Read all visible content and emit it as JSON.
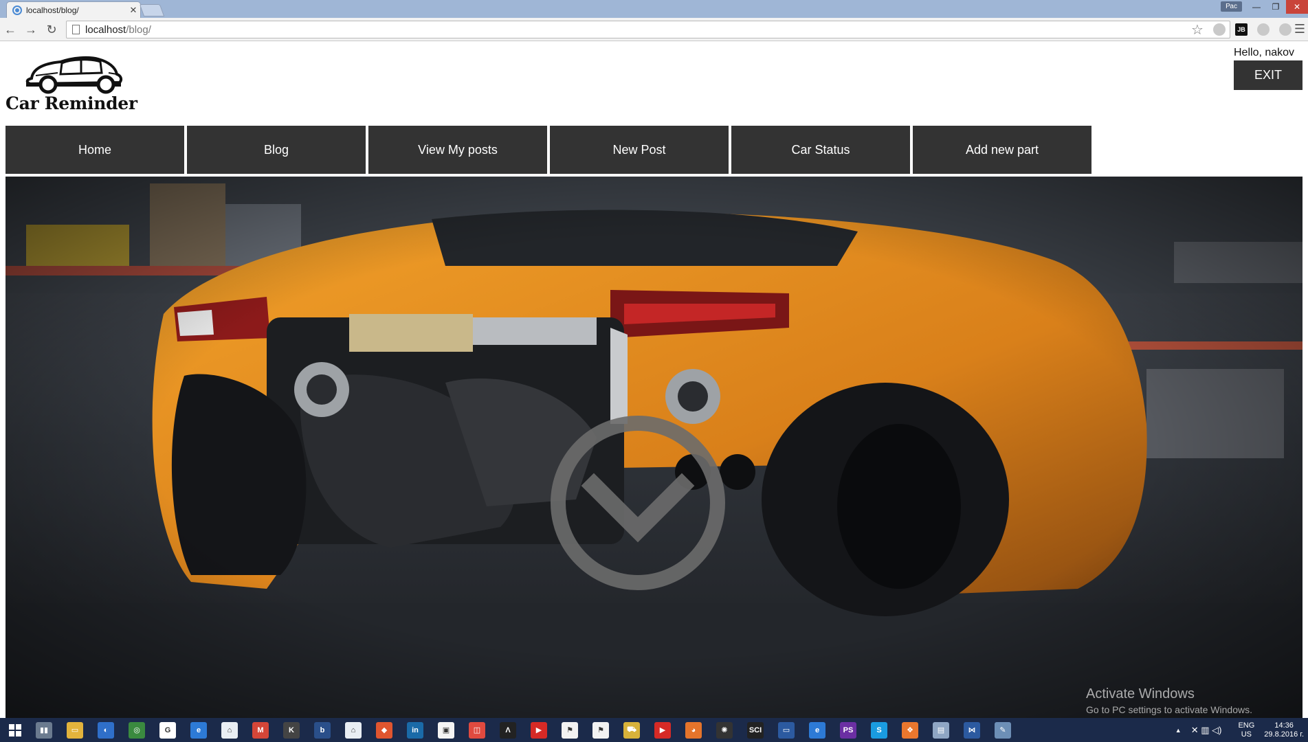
{
  "browser": {
    "tab_title": "localhost/blog/",
    "tab_close": "✕",
    "user_badge": "Рас",
    "window_controls": {
      "minimize": "—",
      "maximize": "❐",
      "close": "✕"
    },
    "address": {
      "host": "localhost",
      "path": "/blog/"
    },
    "nav_icons": {
      "back": "←",
      "forward": "→",
      "reload": "↻"
    },
    "bookmark_star": "☆",
    "menu_icon": "☰",
    "extensions": [
      {
        "name": "cloud-extension-icon",
        "label": ""
      },
      {
        "name": "jetbrains-extension-icon",
        "label": "JB"
      },
      {
        "name": "grey-circle-extension-icon",
        "label": ""
      },
      {
        "name": "m-extension-icon",
        "label": ""
      }
    ]
  },
  "site": {
    "logo_text": "Car Reminder",
    "greeting": "Hello, nakov",
    "exit_label": "EXIT",
    "nav": [
      {
        "label": "Home"
      },
      {
        "label": "Blog"
      },
      {
        "label": "View My posts"
      },
      {
        "label": "New Post"
      },
      {
        "label": "Car Status"
      },
      {
        "label": "Add new part"
      }
    ]
  },
  "watermark": {
    "line1": "Activate Windows",
    "line2": "Go to PC settings to activate Windows."
  },
  "taskbar": {
    "apps": [
      {
        "name": "file-explorer-pinned-icon",
        "color": "#6b7b8f",
        "label": "▮▮"
      },
      {
        "name": "folder-icon",
        "color": "#e2b33c",
        "label": "▭"
      },
      {
        "name": "firefox-icon",
        "color": "#2f6fc9",
        "label": "◐"
      },
      {
        "name": "chrome-icon",
        "color": "#3a8a3f",
        "label": "◎"
      },
      {
        "name": "google-icon",
        "color": "#ffffff",
        "label": "G"
      },
      {
        "name": "internet-explorer-icon",
        "color": "#2d7ad6",
        "label": "e"
      },
      {
        "name": "app-icon-1",
        "color": "#e9eef4",
        "label": "⌂"
      },
      {
        "name": "gmail-icon",
        "color": "#d44638",
        "label": "M"
      },
      {
        "name": "app-icon-2",
        "color": "#444444",
        "label": "K"
      },
      {
        "name": "bitbucket-icon",
        "color": "#2a4f8a",
        "label": "b"
      },
      {
        "name": "app-icon-3",
        "color": "#e9eef4",
        "label": "⌂"
      },
      {
        "name": "git-icon",
        "color": "#e0552f",
        "label": "◆"
      },
      {
        "name": "linkedin-icon",
        "color": "#1a6aa8",
        "label": "in"
      },
      {
        "name": "app-icon-4",
        "color": "#f4f4f4",
        "label": "▣"
      },
      {
        "name": "app-icon-5",
        "color": "#e04a3f",
        "label": "◫"
      },
      {
        "name": "app-icon-6",
        "color": "#222222",
        "label": "Λ"
      },
      {
        "name": "youtube-icon",
        "color": "#d62a26",
        "label": "▶"
      },
      {
        "name": "app-icon-7",
        "color": "#f2f2f2",
        "label": "⚑"
      },
      {
        "name": "app-icon-8",
        "color": "#f2f2f2",
        "label": "⚑"
      },
      {
        "name": "app-icon-9",
        "color": "#d8b23a",
        "label": "⛟"
      },
      {
        "name": "youtube-2-icon",
        "color": "#d62a26",
        "label": "▶"
      },
      {
        "name": "app-icon-10",
        "color": "#e5742b",
        "label": "◕"
      },
      {
        "name": "app-icon-11",
        "color": "#333333",
        "label": "✺"
      },
      {
        "name": "sci-icon",
        "color": "#222222",
        "label": "SCI"
      },
      {
        "name": "app-icon-12",
        "color": "#2c5aa0",
        "label": "▭"
      },
      {
        "name": "internet-explorer-2-icon",
        "color": "#2d7ad6",
        "label": "e"
      },
      {
        "name": "phpstorm-icon",
        "color": "#6b2fa3",
        "label": "PS"
      },
      {
        "name": "skype-icon",
        "color": "#1a9be0",
        "label": "S"
      },
      {
        "name": "app-icon-13",
        "color": "#e9772e",
        "label": "❖"
      },
      {
        "name": "app-icon-14",
        "color": "#8fa6c4",
        "label": "▤"
      },
      {
        "name": "visual-studio-icon",
        "color": "#2c5aa0",
        "label": "⋈"
      },
      {
        "name": "paint-icon",
        "color": "#6d8fb6",
        "label": "✎"
      }
    ],
    "tray": {
      "arrow": "▲",
      "icons": "✕ ▥ ◁)",
      "lang_line1": "ENG",
      "lang_line2": "US",
      "time": "14:36",
      "date": "29.8.2016 г."
    }
  }
}
